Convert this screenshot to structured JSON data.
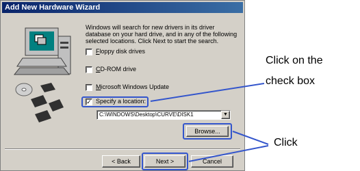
{
  "window": {
    "title": "Add New Hardware Wizard",
    "description": "Windows will search for new drivers in its driver database on your hard drive, and in any of the following selected locations. Click Next to start the search."
  },
  "options": [
    {
      "label_first": "F",
      "label_rest": "loppy disk drives",
      "checked": false
    },
    {
      "label_first": "C",
      "label_rest": "D-ROM drive",
      "checked": false
    },
    {
      "label_first": "M",
      "label_rest": "icrosoft Windows Update",
      "checked": false
    },
    {
      "label_first": "",
      "label_rest": "Specify a location:",
      "checked": true
    }
  ],
  "location": {
    "value": "C:\\WINDOWS\\Desktop\\CURVE\\DISK1"
  },
  "buttons": {
    "browse": "Browse...",
    "back": "< Back",
    "next": "Next >",
    "cancel": "Cancel"
  },
  "annotations": {
    "checkbox_line1": "Click on the",
    "checkbox_line2": "check box",
    "click": "Click"
  },
  "colors": {
    "highlight": "#3355cc",
    "titlebar": "#0a246a"
  }
}
